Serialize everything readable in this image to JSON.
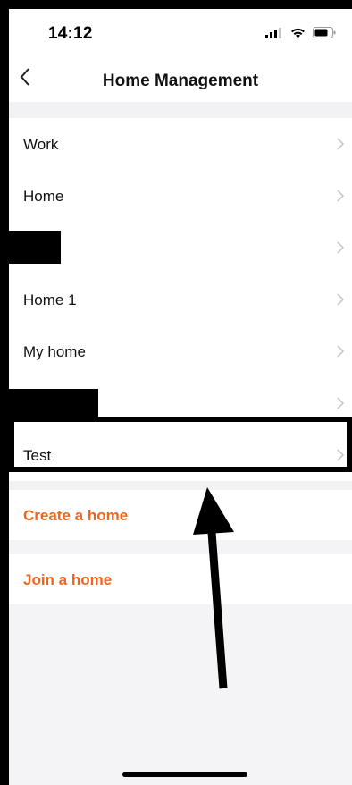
{
  "status_bar": {
    "time": "14:12"
  },
  "nav": {
    "title": "Home Management",
    "back_icon": "chevron-left-icon"
  },
  "homes": [
    {
      "label": "Work",
      "redacted": false
    },
    {
      "label": "Home",
      "redacted": false
    },
    {
      "label": "",
      "redacted": true
    },
    {
      "label": "Home 1",
      "redacted": false
    },
    {
      "label": "My home",
      "redacted": false
    },
    {
      "label": "",
      "redacted": true
    },
    {
      "label": "Test",
      "redacted": false,
      "highlighted": true
    }
  ],
  "actions": {
    "create_label": "Create a home",
    "join_label": "Join a home"
  },
  "colors": {
    "accent": "#f0651e",
    "background": "#f4f4f6",
    "row_background": "#ffffff",
    "chevron": "#c7c7cc"
  }
}
